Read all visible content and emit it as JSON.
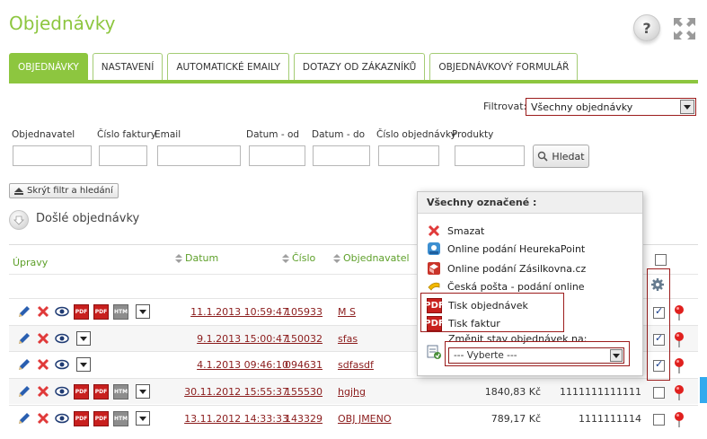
{
  "header": {
    "title": "Objednávky",
    "help_label": "?"
  },
  "tabs": [
    "OBJEDNÁVKY",
    "NASTAVENÍ",
    "AUTOMATICKÉ EMAILY",
    "DOTAZY OD ZÁKAZNÍKŮ",
    "OBJEDNÁVKOVÝ FORMULÁŘ"
  ],
  "filter": {
    "label": "Filtrovat:",
    "selected": "Všechny objednávky"
  },
  "search_fields": {
    "customer": "Objednavatel",
    "invoice_number": "Číslo faktury",
    "email": "Email",
    "date_from": "Datum - od",
    "date_to": "Datum - do",
    "order_number": "Číslo objednávky",
    "products": "Produkty",
    "search_button": "Hledat"
  },
  "hide_filter_button": "Skrýt filtr a hledání",
  "section_title": "Došlé objednávky",
  "table": {
    "headers": {
      "edits": "Úpravy",
      "date": "Datum",
      "number": "Číslo",
      "customer": "Objednavatel"
    },
    "rows": [
      {
        "date": "11.1.2013 10:59:47",
        "number": "105933",
        "customer": "M S",
        "amount": "",
        "phone": "",
        "checked": true,
        "pdf": true
      },
      {
        "date": "9.1.2013 15:00:47",
        "number": "150032",
        "customer": "sfas",
        "amount": "",
        "phone": "",
        "checked": true,
        "pdf": false
      },
      {
        "date": "4.1.2013 09:46:10",
        "number": "094631",
        "customer": "sdfasdf",
        "amount": "",
        "phone": "",
        "checked": true,
        "pdf": false
      },
      {
        "date": "30.11.2012 15:55:37",
        "number": "155530",
        "customer": "hgjhg",
        "amount": "1840,83 Kč",
        "phone": "1111111111111",
        "checked": false,
        "pdf": true
      },
      {
        "date": "13.11.2012 14:33:33",
        "number": "143329",
        "customer": "OBJ JMENO",
        "amount": "789,17 Kč",
        "phone": "1111111114",
        "checked": false,
        "pdf": true
      }
    ]
  },
  "popup": {
    "title": "Všechny označené :",
    "items": [
      {
        "label": "Smazat",
        "icon": "delete-icon"
      },
      {
        "label": "Online podání HeurekaPoint",
        "icon": "heureka-icon"
      },
      {
        "label": "Online podání Zásilkovna.cz",
        "icon": "zasilkovna-icon"
      },
      {
        "label": "Česká pošta - podání online",
        "icon": "post-horn-icon"
      },
      {
        "label": "Tisk objednávek",
        "icon": "pdf-icon"
      },
      {
        "label": "Tisk faktur",
        "icon": "pdf-icon"
      }
    ],
    "status_label": "Změnit stav objednávek na:",
    "status_select": "--- Vyberte ---"
  },
  "colors": {
    "accent": "#8dc63f",
    "link": "#8b1c1c",
    "highlight": "#9c1c1c"
  }
}
